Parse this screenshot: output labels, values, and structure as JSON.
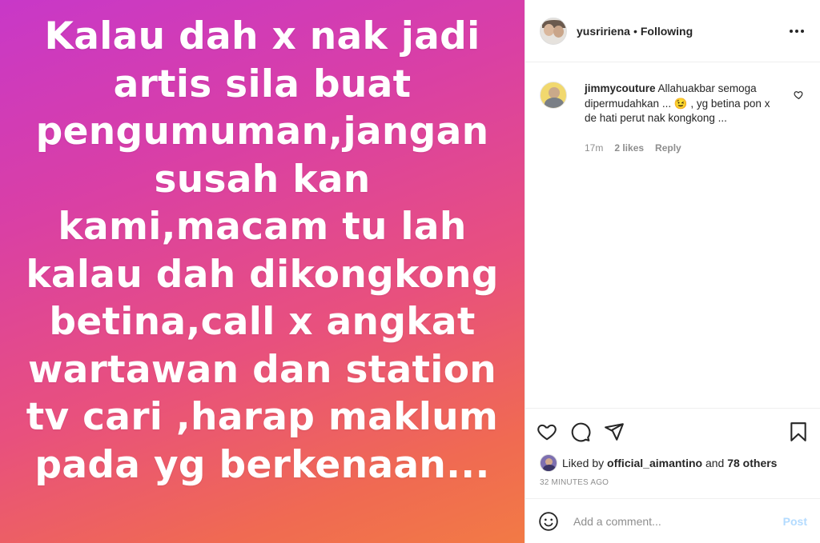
{
  "post_image": {
    "text": "Kalau dah x nak jadi\nartis sila buat\npengumuman,jangan\nsusah kan\nkami,macam tu lah\nkalau dah dikongkong\nbetina,call x angkat\nwartawan dan  station\ntv cari ,harap maklum\npada yg berkenaan..."
  },
  "header": {
    "username": "yusririena",
    "separator": "•",
    "follow_status": "Following",
    "more_icon": "more-horizontal-icon"
  },
  "comments": [
    {
      "username": "jimmycouture",
      "text": "Allahuakbar semoga dipermudahkan ... 😉 , yg betina pon x de hati perut nak kongkong ...",
      "time": "17m",
      "likes": "2 likes",
      "reply_label": "Reply"
    }
  ],
  "actions": {
    "like_icon": "heart-icon",
    "comment_icon": "comment-icon",
    "share_icon": "share-icon",
    "save_icon": "bookmark-icon"
  },
  "likes": {
    "prefix": "Liked by",
    "user": "official_aimantino",
    "middle": "and",
    "others": "78 others"
  },
  "timestamp": "32 MINUTES AGO",
  "add_comment": {
    "placeholder": "Add a comment...",
    "post_label": "Post",
    "emoji_icon": "smiley-icon"
  },
  "colors": {
    "gradient_start": "#c838c8",
    "gradient_end": "#f27a45",
    "post_button": "#b3dbff",
    "muted": "#8e8e8e"
  }
}
